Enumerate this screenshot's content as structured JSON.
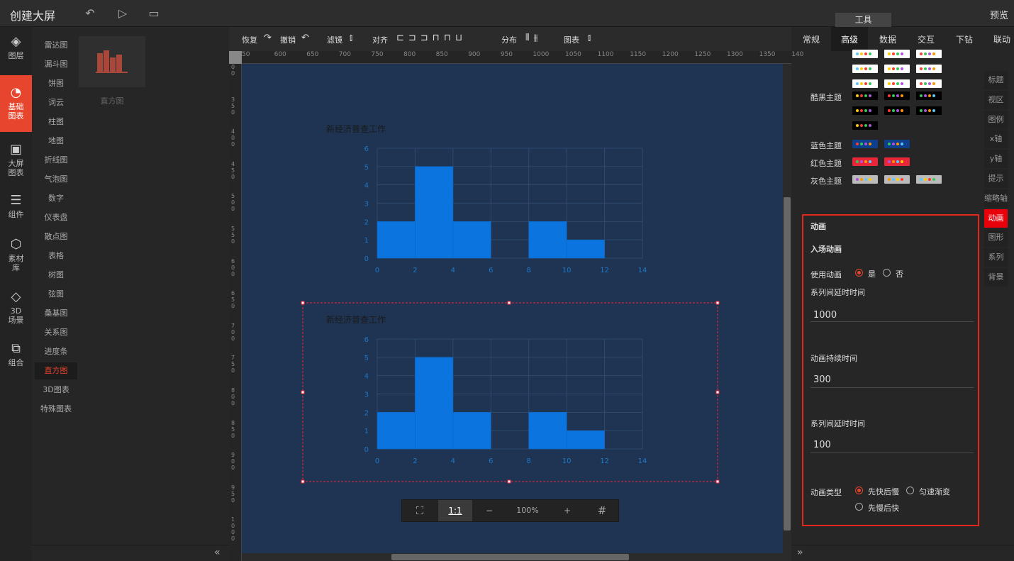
{
  "header": {
    "title": "创建大屏",
    "preview": "预览",
    "tools_tab": "工具"
  },
  "leftnav": [
    {
      "label": "图层",
      "icon": "layers-icon",
      "glyph": "◈"
    },
    {
      "label": "基础图表",
      "icon": "pie-chart-icon",
      "glyph": "◔",
      "active": true
    },
    {
      "label": "大屏图表",
      "icon": "monitor-chart-icon",
      "glyph": "▣"
    },
    {
      "label": "组件",
      "icon": "sliders-icon",
      "glyph": "☰"
    },
    {
      "label": "素材库",
      "icon": "hexagons-icon",
      "glyph": "⬡"
    },
    {
      "label": "3D场景",
      "icon": "cube-icon",
      "glyph": "◇"
    },
    {
      "label": "组合",
      "icon": "group-icon",
      "glyph": "⧉"
    }
  ],
  "categories": [
    "雷达图",
    "漏斗图",
    "饼图",
    "词云",
    "柱图",
    "地图",
    "折线图",
    "气泡图",
    "数字",
    "仪表盘",
    "散点图",
    "表格",
    "树图",
    "弦图",
    "桑基图",
    "关系图",
    "进度条",
    "直方图",
    "3D图表",
    "特殊图表"
  ],
  "active_category": "直方图",
  "thumbnail_label": "直方图",
  "toolbar": {
    "restore": "恢复",
    "undo": "撤销",
    "filter": "滤镜",
    "align": "对齐",
    "distribute": "分布",
    "chart": "图表"
  },
  "ruler_h": [
    "50",
    "600",
    "650",
    "700",
    "750",
    "800",
    "850",
    "900",
    "950",
    "1000",
    "1050",
    "1100",
    "1150",
    "1200",
    "1250",
    "1300",
    "1350",
    "140"
  ],
  "ruler_v": [
    "00",
    "350",
    "400",
    "450",
    "500",
    "550",
    "600",
    "650",
    "700",
    "750",
    "800",
    "850",
    "900",
    "950",
    "1000"
  ],
  "chart_data": [
    {
      "type": "bar",
      "title": "新经济普查工作",
      "x_edges": [
        0,
        2,
        4,
        6,
        8,
        10,
        12,
        14
      ],
      "values": [
        2,
        5,
        2,
        0,
        2,
        1,
        0
      ],
      "ylim": [
        0,
        6
      ],
      "xlim": [
        0,
        14
      ],
      "yticks": [
        0,
        1,
        2,
        3,
        4,
        5,
        6
      ],
      "xticks": [
        0,
        2,
        4,
        6,
        8,
        10,
        12,
        14
      ],
      "color": "#0b74de"
    },
    {
      "type": "bar",
      "title": "新经济普查工作",
      "x_edges": [
        0,
        2,
        4,
        6,
        8,
        10,
        12,
        14
      ],
      "values": [
        2,
        5,
        2,
        0,
        2,
        1,
        0
      ],
      "ylim": [
        0,
        6
      ],
      "xlim": [
        0,
        14
      ],
      "yticks": [
        0,
        1,
        2,
        3,
        4,
        5,
        6
      ],
      "xticks": [
        0,
        2,
        4,
        6,
        8,
        10,
        12,
        14
      ],
      "color": "#0b74de"
    }
  ],
  "zoom": {
    "fit": "⛶",
    "one_to_one": "1:1",
    "minus": "−",
    "value": "100%",
    "plus": "+",
    "grid": "#"
  },
  "right_tabs": [
    "常规",
    "高级",
    "数据",
    "交互",
    "下钻",
    "联动"
  ],
  "right_active_tab": "高级",
  "themes": [
    {
      "label": "",
      "top": 76,
      "rows": [
        [
          "#ffffff",
          "#ffffff",
          "#ffffff"
        ],
        [
          "#ffffff",
          "#ffffff",
          "#ffffff"
        ],
        [
          "#ffffff",
          "#ffffff",
          "#ffffff"
        ]
      ]
    },
    {
      "label": "酷黑主题",
      "top": 135,
      "rows": [
        [
          "#000",
          "#000",
          "#000"
        ],
        [
          "#000",
          "#000",
          "#000"
        ],
        [
          "#000"
        ]
      ]
    },
    {
      "label": "蓝色主题",
      "top": 203,
      "rows": [
        [
          "#0e3f8c",
          "#0e3f8c"
        ]
      ]
    },
    {
      "label": "红色主题",
      "top": 228,
      "rows": [
        [
          "#e8263a",
          "#e8263a"
        ]
      ]
    },
    {
      "label": "灰色主题",
      "top": 253,
      "rows": [
        [
          "#bbbbbb",
          "#bbbbbb",
          "#bbbbbb"
        ]
      ]
    }
  ],
  "side_tabs": [
    "标题",
    "视区",
    "图例",
    "x轴",
    "y轴",
    "提示",
    "缩略轴",
    "动画",
    "图形",
    "系列",
    "背景"
  ],
  "side_active": "动画",
  "animation": {
    "section": "动画",
    "enter": "入场动画",
    "use_label": "使用动画",
    "yes": "是",
    "no": "否",
    "delay_label": "系列间延时时间",
    "delay_value": "1000",
    "duration_label": "动画持续时间",
    "duration_value": "300",
    "delay2_label": "系列间延时时间",
    "delay2_value": "100",
    "type_label": "动画类型",
    "type_opt1": "先快后慢",
    "type_opt2": "匀速渐变",
    "type_opt3": "先慢后快"
  }
}
